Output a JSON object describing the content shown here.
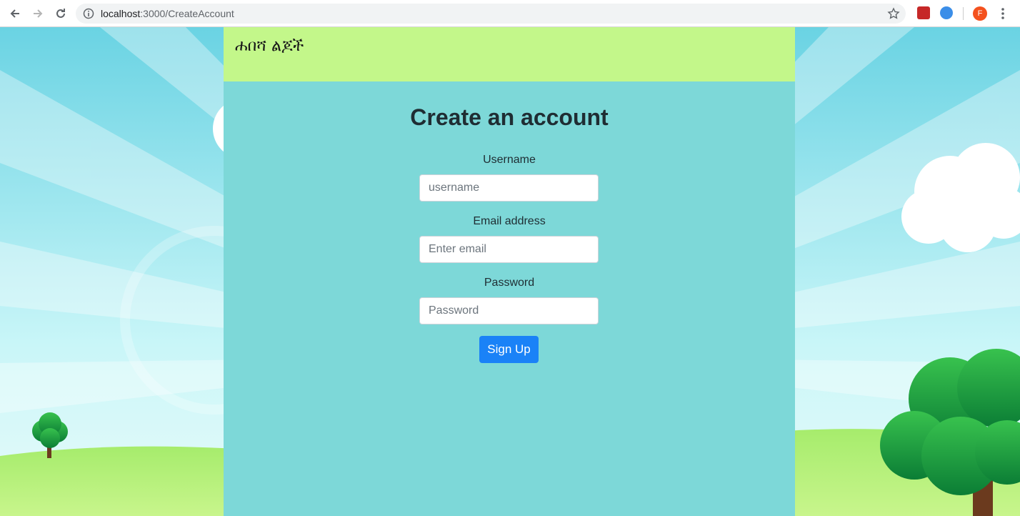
{
  "browser": {
    "url_host": "localhost",
    "url_path": ":3000/CreateAccount",
    "profile_initial": "F",
    "icons": [
      "back-icon",
      "forward-icon",
      "reload-icon",
      "info-icon",
      "star-icon",
      "extension-icon",
      "menu-icon"
    ]
  },
  "navbar": {
    "brand": "ሐበሻ ልጆች"
  },
  "form": {
    "title": "Create an account",
    "username_label": "Username",
    "username_placeholder": "username",
    "email_label": "Email address",
    "email_placeholder": "Enter email",
    "password_label": "Password",
    "password_placeholder": "Password",
    "submit_label": "Sign Up"
  },
  "colors": {
    "navbar_bg": "#c3f78a",
    "content_bg": "#7dd8d8",
    "button_bg": "#1a82f7"
  }
}
